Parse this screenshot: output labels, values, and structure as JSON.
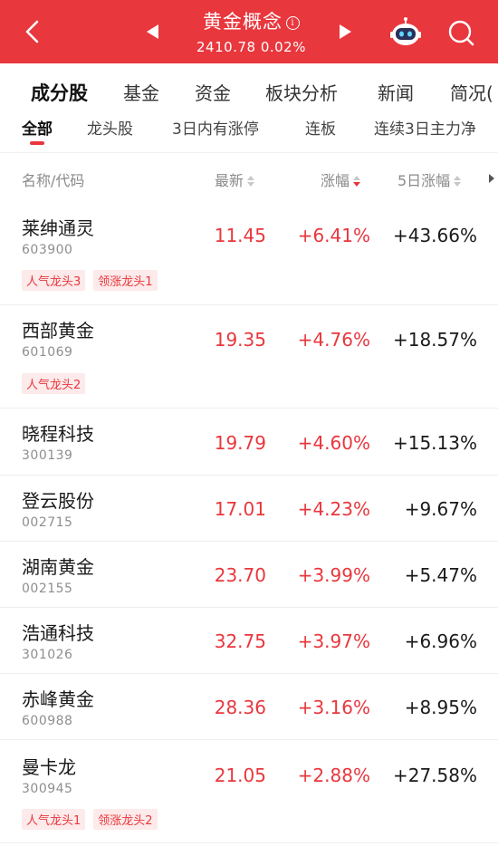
{
  "header": {
    "title": "黄金概念",
    "info_icon": "i",
    "index_value": "2410.78",
    "index_change": "0.02%",
    "bg_color": "#e8373d"
  },
  "main_tabs": [
    "成分股",
    "基金",
    "资金",
    "板块分析",
    "新闻",
    "简况("
  ],
  "sub_tabs": [
    "全部",
    "龙头股",
    "3日内有涨停",
    "连板",
    "连续3日主力净"
  ],
  "columns": {
    "name_code": "名称/代码",
    "latest": "最新",
    "change": "涨幅",
    "change5": "5日涨幅"
  },
  "stocks": [
    {
      "name": "莱绅通灵",
      "code": "603900",
      "price": "11.45",
      "change": "+6.41%",
      "change5": "+43.66%",
      "tags": [
        "人气龙头3",
        "领涨龙头1"
      ]
    },
    {
      "name": "西部黄金",
      "code": "601069",
      "price": "19.35",
      "change": "+4.76%",
      "change5": "+18.57%",
      "tags": [
        "人气龙头2"
      ]
    },
    {
      "name": "晓程科技",
      "code": "300139",
      "price": "19.79",
      "change": "+4.60%",
      "change5": "+15.13%",
      "tags": []
    },
    {
      "name": "登云股份",
      "code": "002715",
      "price": "17.01",
      "change": "+4.23%",
      "change5": "+9.67%",
      "tags": []
    },
    {
      "name": "湖南黄金",
      "code": "002155",
      "price": "23.70",
      "change": "+3.99%",
      "change5": "+5.47%",
      "tags": []
    },
    {
      "name": "浩通科技",
      "code": "301026",
      "price": "32.75",
      "change": "+3.97%",
      "change5": "+6.96%",
      "tags": []
    },
    {
      "name": "赤峰黄金",
      "code": "600988",
      "price": "28.36",
      "change": "+3.16%",
      "change5": "+8.95%",
      "tags": []
    },
    {
      "name": "曼卡龙",
      "code": "300945",
      "price": "21.05",
      "change": "+2.88%",
      "change5": "+27.58%",
      "tags": [
        "人气龙头1",
        "领涨龙头2"
      ]
    }
  ],
  "icons": {
    "back": "back-icon",
    "prev": "prev-arrow-icon",
    "next": "next-arrow-icon",
    "assistant": "robot-assistant-icon",
    "search": "search-icon"
  }
}
